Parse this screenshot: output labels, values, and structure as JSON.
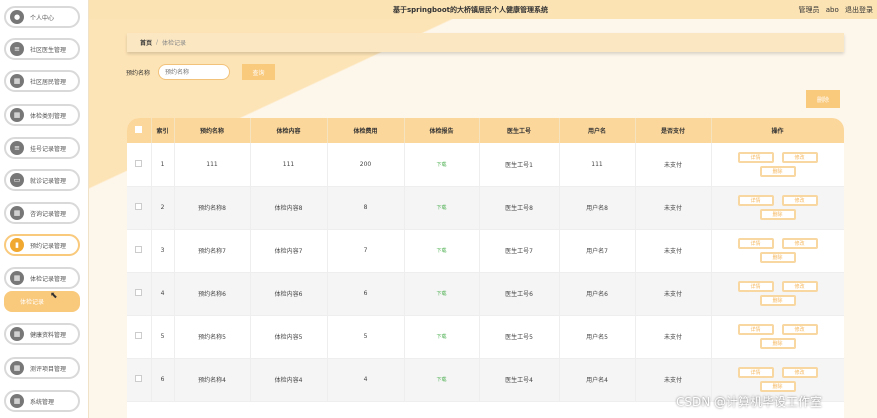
{
  "app_title": "基于springboot的大桥镇居民个人健康管理系统",
  "user": {
    "role": "管理员",
    "name": "abo",
    "logout": "退出登录"
  },
  "sidebar": {
    "items": [
      {
        "label": "个人中心",
        "icon": "person-icon"
      },
      {
        "label": "社区医生管理",
        "icon": "list-icon"
      },
      {
        "label": "社区居民管理",
        "icon": "grid-icon"
      },
      {
        "label": "体检类别管理",
        "icon": "grid-icon"
      },
      {
        "label": "挂号记录管理",
        "icon": "list-icon"
      },
      {
        "label": "就诊记录管理",
        "icon": "chat-icon"
      },
      {
        "label": "咨询记录管理",
        "icon": "grid-icon"
      },
      {
        "label": "预约记录管理",
        "icon": "chart-icon"
      },
      {
        "label": "体检记录管理",
        "icon": "grid-icon"
      },
      {
        "label": "健康资料管理",
        "icon": "grid-icon"
      },
      {
        "label": "测评项目管理",
        "icon": "grid-icon"
      },
      {
        "label": "系统管理",
        "icon": "grid-icon"
      }
    ],
    "submenu_label": "体检记录"
  },
  "breadcrumb": {
    "home": "首页",
    "separator": "/",
    "current": "体检记录"
  },
  "search": {
    "label": "预约名称",
    "placeholder": "预约名称",
    "query_label": "查询"
  },
  "delete_label": "删除",
  "table": {
    "headers": [
      "索引",
      "预约名称",
      "体检内容",
      "体检费用",
      "体检报告",
      "医生工号",
      "用户名",
      "是否支付",
      "操作"
    ],
    "rows": [
      {
        "index": "1",
        "name": "111",
        "content": "111",
        "fee": "200",
        "report": "下载",
        "doctor": "医生工号1",
        "user": "111",
        "paid": "未支付"
      },
      {
        "index": "2",
        "name": "预约名称8",
        "content": "体检内容8",
        "fee": "8",
        "report": "下载",
        "doctor": "医生工号8",
        "user": "用户名8",
        "paid": "未支付"
      },
      {
        "index": "3",
        "name": "预约名称7",
        "content": "体检内容7",
        "fee": "7",
        "report": "下载",
        "doctor": "医生工号7",
        "user": "用户名7",
        "paid": "未支付"
      },
      {
        "index": "4",
        "name": "预约名称6",
        "content": "体检内容6",
        "fee": "6",
        "report": "下载",
        "doctor": "医生工号6",
        "user": "用户名6",
        "paid": "未支付"
      },
      {
        "index": "5",
        "name": "预约名称5",
        "content": "体检内容5",
        "fee": "5",
        "report": "下载",
        "doctor": "医生工号5",
        "user": "用户名5",
        "paid": "未支付"
      },
      {
        "index": "6",
        "name": "预约名称4",
        "content": "体检内容4",
        "fee": "4",
        "report": "下载",
        "doctor": "医生工号4",
        "user": "用户名4",
        "paid": "未支付"
      }
    ],
    "op_labels": {
      "detail": "详情",
      "edit": "修改",
      "delete": "删除"
    }
  },
  "watermark": "CSDN @计算机毕设工作室",
  "colors": {
    "accent": "#f9c97c",
    "topbar": "#fbe3b4",
    "header_row": "#fbd79b",
    "download": "#4caf50"
  }
}
